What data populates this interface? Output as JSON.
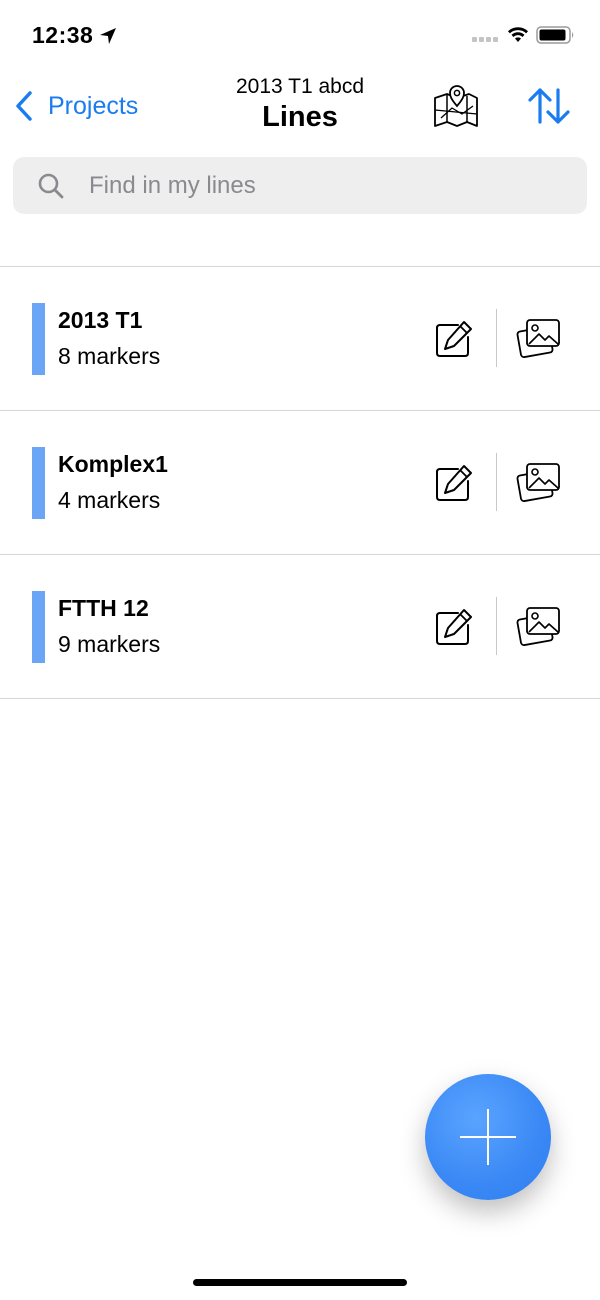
{
  "status_bar": {
    "time": "12:38"
  },
  "nav": {
    "back_label": "Projects",
    "subtitle": "2013 T1 abcd",
    "title": "Lines"
  },
  "search": {
    "placeholder": "Find in my lines",
    "value": ""
  },
  "lines": [
    {
      "name": "2013 T1",
      "markers": "8 markers",
      "color": "#6aa6f5"
    },
    {
      "name": "Komplex1",
      "markers": "4 markers",
      "color": "#6aa6f5"
    },
    {
      "name": "FTTH 12",
      "markers": "9 markers",
      "color": "#6aa6f5"
    }
  ],
  "colors": {
    "accent": "#1a7cf0",
    "fab": "#3a88f5"
  },
  "icons": {
    "back": "chevron-left-icon",
    "map": "map-pin-icon",
    "sort": "sort-arrows-icon",
    "search": "search-icon",
    "edit": "edit-pencil-icon",
    "gallery": "photo-gallery-icon",
    "add": "plus-icon"
  }
}
